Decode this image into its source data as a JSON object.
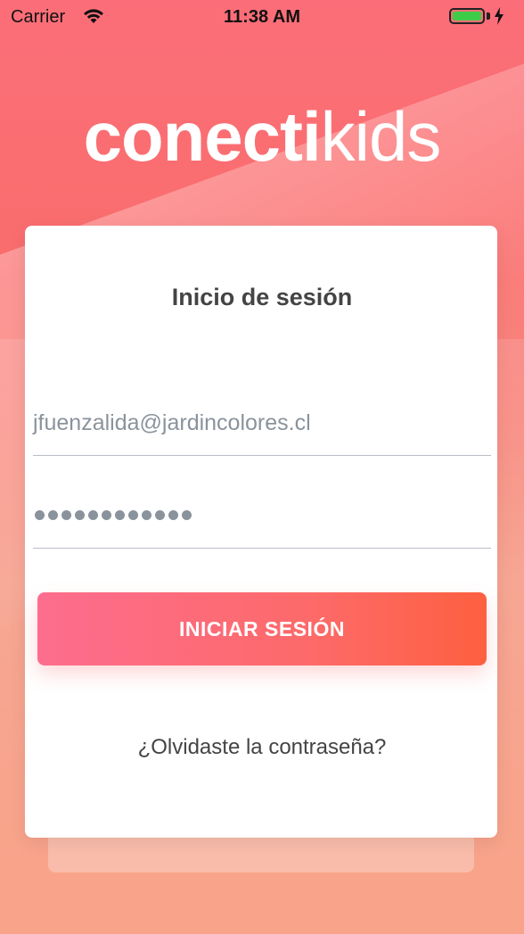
{
  "status_bar": {
    "carrier": "Carrier",
    "time": "11:38 AM",
    "battery_color": "#3fcc48"
  },
  "logo": {
    "bold_part": "conecti",
    "light_part": "kids"
  },
  "login": {
    "title": "Inicio de sesión",
    "email_value": "jfuenzalida@jardincolores.cl",
    "password_masked_count": 12,
    "submit_label": "INICIAR SESIÓN",
    "forgot_label": "¿Olvidaste la contraseña?"
  },
  "colors": {
    "accent_start": "#fd6d8e",
    "accent_end": "#fd6040",
    "background_top": "#fb6e79",
    "background_bottom": "#f9a48a"
  }
}
